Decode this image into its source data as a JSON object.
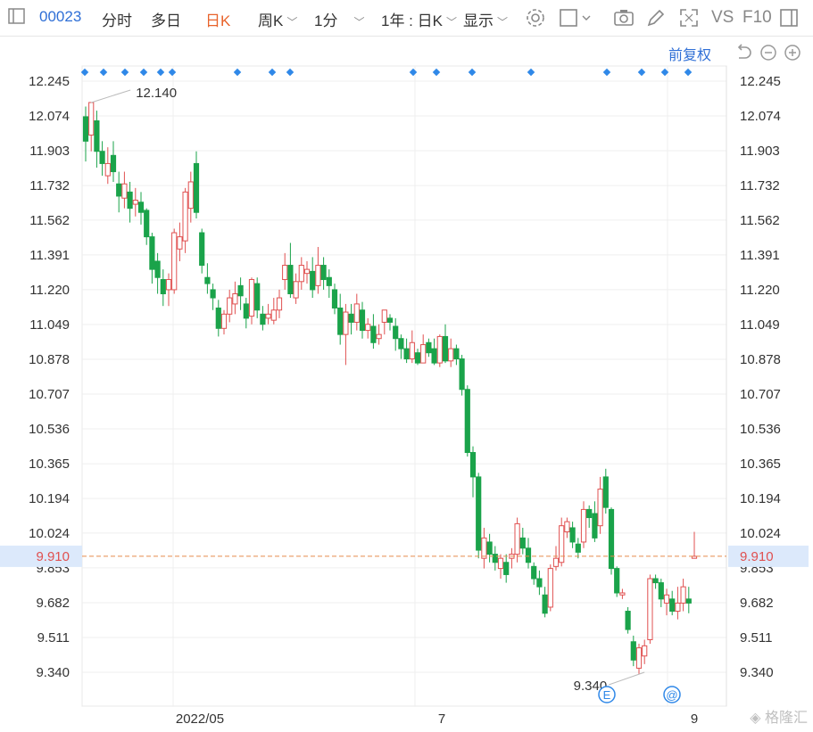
{
  "toolbar": {
    "stock_code": "00023",
    "tabs": [
      "分时",
      "多日",
      "日K",
      "周K",
      "1分"
    ],
    "active_tab": "日K",
    "range_label": "1年 : 日K",
    "display_label": "显示",
    "vs_label": "VS",
    "f10_label": "F10"
  },
  "adjust_label": "前复权",
  "colors": {
    "up": "#e05050",
    "down": "#1aa34a",
    "accent": "#2f6fd6",
    "price_line": "#e58a4c",
    "active_tab": "#e8632b"
  },
  "current_price": "9.910",
  "chart_data": {
    "type": "candlestick",
    "y_ticks": [
      "12.245",
      "12.074",
      "11.903",
      "11.732",
      "11.562",
      "11.391",
      "11.220",
      "11.049",
      "10.878",
      "10.707",
      "10.536",
      "10.365",
      "10.194",
      "10.024",
      "9.853",
      "9.682",
      "9.511",
      "9.340"
    ],
    "x_ticks": [
      "2022/05",
      "7",
      "9"
    ],
    "ylim": [
      9.34,
      12.245
    ],
    "high_marker": "12.140",
    "low_marker": "9.340",
    "event_markers": [
      "E",
      "@"
    ],
    "candles": [
      [
        12.07,
        11.95,
        12.12,
        11.85
      ],
      [
        11.98,
        12.14,
        12.14,
        11.9
      ],
      [
        12.05,
        11.9,
        12.1,
        11.82
      ],
      [
        11.9,
        11.84,
        11.95,
        11.78
      ],
      [
        11.78,
        11.84,
        11.92,
        11.74
      ],
      [
        11.88,
        11.8,
        11.95,
        11.75
      ],
      [
        11.74,
        11.68,
        11.8,
        11.6
      ],
      [
        11.67,
        11.74,
        11.8,
        11.62
      ],
      [
        11.7,
        11.62,
        11.75,
        11.55
      ],
      [
        11.64,
        11.66,
        11.72,
        11.58
      ],
      [
        11.65,
        11.6,
        11.7,
        11.54
      ],
      [
        11.61,
        11.48,
        11.62,
        11.44
      ],
      [
        11.48,
        11.32,
        11.5,
        11.25
      ],
      [
        11.36,
        11.28,
        11.4,
        11.2
      ],
      [
        11.27,
        11.2,
        11.32,
        11.14
      ],
      [
        11.22,
        11.27,
        11.3,
        11.14
      ],
      [
        11.22,
        11.5,
        11.52,
        11.2
      ],
      [
        11.42,
        11.48,
        11.55,
        11.36
      ],
      [
        11.46,
        11.7,
        11.72,
        11.4
      ],
      [
        11.62,
        11.75,
        11.8,
        11.55
      ],
      [
        11.84,
        11.6,
        11.9,
        11.57
      ],
      [
        11.5,
        11.34,
        11.52,
        11.3
      ],
      [
        11.28,
        11.25,
        11.35,
        11.2
      ],
      [
        11.22,
        11.18,
        11.25,
        11.12
      ],
      [
        11.13,
        11.03,
        11.17,
        10.99
      ],
      [
        11.03,
        11.1,
        11.12,
        11.0
      ],
      [
        11.1,
        11.18,
        11.22,
        11.06
      ],
      [
        11.15,
        11.2,
        11.26,
        11.1
      ],
      [
        11.24,
        11.19,
        11.28,
        11.12
      ],
      [
        11.15,
        11.08,
        11.18,
        11.03
      ],
      [
        11.09,
        11.27,
        11.28,
        11.05
      ],
      [
        11.25,
        11.12,
        11.28,
        11.08
      ],
      [
        11.1,
        11.05,
        11.14,
        11.02
      ],
      [
        11.08,
        11.1,
        11.15,
        11.05
      ],
      [
        11.07,
        11.12,
        11.18,
        11.05
      ],
      [
        11.12,
        11.18,
        11.22,
        11.08
      ],
      [
        11.27,
        11.34,
        11.4,
        11.22
      ],
      [
        11.34,
        11.2,
        11.45,
        11.18
      ],
      [
        11.18,
        11.26,
        11.3,
        11.15
      ],
      [
        11.26,
        11.34,
        11.38,
        11.22
      ],
      [
        11.3,
        11.32,
        11.36,
        11.25
      ],
      [
        11.31,
        11.22,
        11.38,
        11.18
      ],
      [
        11.24,
        11.34,
        11.43,
        11.2
      ],
      [
        11.34,
        11.27,
        11.38,
        11.22
      ],
      [
        11.28,
        11.24,
        11.32,
        11.18
      ],
      [
        11.22,
        11.13,
        11.25,
        11.1
      ],
      [
        11.13,
        11.0,
        11.2,
        10.95
      ],
      [
        11.0,
        11.11,
        11.15,
        10.85
      ],
      [
        11.1,
        11.06,
        11.15,
        11.0
      ],
      [
        11.06,
        11.15,
        11.2,
        11.02
      ],
      [
        11.12,
        11.02,
        11.16,
        10.98
      ],
      [
        11.02,
        11.05,
        11.08,
        10.98
      ],
      [
        11.04,
        10.96,
        11.1,
        10.93
      ],
      [
        10.98,
        11.0,
        11.05,
        10.95
      ],
      [
        11.06,
        11.12,
        11.12,
        11.0
      ],
      [
        11.08,
        11.06,
        11.1,
        11.02
      ],
      [
        11.04,
        10.98,
        11.08,
        10.92
      ],
      [
        10.98,
        10.93,
        11.0,
        10.88
      ],
      [
        10.93,
        10.88,
        10.98,
        10.86
      ],
      [
        10.88,
        10.96,
        11.02,
        10.86
      ],
      [
        10.91,
        10.86,
        10.93,
        10.85
      ],
      [
        10.86,
        10.95,
        11.0,
        10.86
      ],
      [
        10.96,
        10.91,
        10.98,
        10.89
      ],
      [
        10.93,
        10.86,
        10.98,
        10.85
      ],
      [
        10.86,
        10.99,
        11.0,
        10.84
      ],
      [
        10.99,
        10.87,
        11.05,
        10.86
      ],
      [
        10.87,
        10.93,
        10.98,
        10.84
      ],
      [
        10.93,
        10.88,
        10.95,
        10.85
      ],
      [
        10.88,
        10.73,
        10.9,
        10.7
      ],
      [
        10.73,
        10.42,
        10.75,
        10.4
      ],
      [
        10.42,
        10.3,
        10.45,
        10.2
      ],
      [
        10.3,
        9.94,
        10.32,
        9.9
      ],
      [
        9.9,
        10.0,
        10.05,
        9.85
      ],
      [
        9.98,
        9.92,
        10.02,
        9.88
      ],
      [
        9.92,
        9.88,
        9.96,
        9.84
      ],
      [
        9.85,
        9.9,
        9.92,
        9.8
      ],
      [
        9.88,
        9.82,
        9.92,
        9.78
      ],
      [
        9.9,
        9.92,
        9.95,
        9.85
      ],
      [
        9.92,
        10.07,
        10.1,
        9.88
      ],
      [
        10.0,
        9.95,
        10.05,
        9.92
      ],
      [
        9.95,
        9.88,
        10.0,
        9.85
      ],
      [
        9.86,
        9.8,
        9.88,
        9.77
      ],
      [
        9.8,
        9.76,
        9.84,
        9.72
      ],
      [
        9.72,
        9.63,
        9.76,
        9.61
      ],
      [
        9.66,
        9.85,
        9.87,
        9.64
      ],
      [
        9.86,
        9.9,
        9.96,
        9.84
      ],
      [
        9.88,
        10.06,
        10.1,
        9.86
      ],
      [
        10.03,
        10.08,
        10.1,
        10.0
      ],
      [
        10.05,
        9.98,
        10.08,
        9.95
      ],
      [
        9.97,
        9.93,
        10.0,
        9.9
      ],
      [
        9.98,
        10.14,
        10.18,
        9.95
      ],
      [
        10.14,
        10.1,
        10.16,
        10.05
      ],
      [
        10.12,
        10.0,
        10.18,
        9.98
      ],
      [
        10.06,
        10.24,
        10.3,
        10.02
      ],
      [
        10.3,
        10.15,
        10.34,
        10.12
      ],
      [
        10.14,
        9.85,
        10.15,
        9.82
      ],
      [
        9.85,
        9.73,
        9.86,
        9.71
      ],
      [
        9.72,
        9.73,
        9.75,
        9.7
      ],
      [
        9.64,
        9.55,
        9.66,
        9.53
      ],
      [
        9.49,
        9.4,
        9.52,
        9.37
      ],
      [
        9.36,
        9.46,
        9.48,
        9.33
      ],
      [
        9.42,
        9.47,
        9.5,
        9.38
      ],
      [
        9.5,
        9.8,
        9.82,
        9.48
      ],
      [
        9.8,
        9.78,
        9.82,
        9.75
      ],
      [
        9.78,
        9.7,
        9.8,
        9.66
      ],
      [
        9.68,
        9.72,
        9.75,
        9.62
      ],
      [
        9.7,
        9.64,
        9.74,
        9.62
      ],
      [
        9.64,
        9.68,
        9.76,
        9.6
      ],
      [
        9.68,
        9.76,
        9.8,
        9.64
      ],
      [
        9.7,
        9.68,
        9.76,
        9.63
      ],
      [
        9.9,
        9.91,
        10.03,
        9.9
      ]
    ]
  }
}
